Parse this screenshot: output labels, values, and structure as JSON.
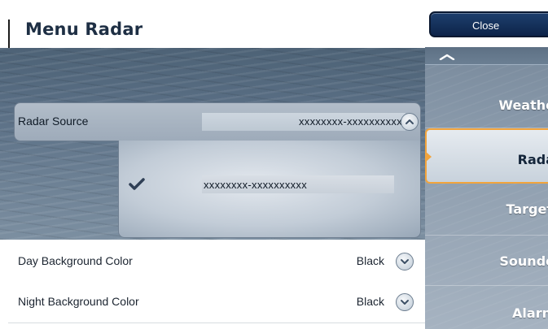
{
  "header": {
    "title": "Menu Radar"
  },
  "radar_source": {
    "label": "Radar Source",
    "value": "xxxxxxxx-xxxxxxxxxx",
    "expanded": true,
    "options": [
      {
        "value": "xxxxxxxx-xxxxxxxxxx",
        "selected": true
      }
    ]
  },
  "settings": [
    {
      "label": "Day Background Color",
      "value": "Black"
    },
    {
      "label": "Night Background Color",
      "value": "Black"
    }
  ],
  "sidebar": {
    "close_label": "Close",
    "items": [
      {
        "label": "Weathe",
        "selected": false
      },
      {
        "label": "Rada",
        "selected": true
      },
      {
        "label": "Target",
        "selected": false
      },
      {
        "label": "Sounde",
        "selected": false
      },
      {
        "label": "Alarn",
        "selected": false
      }
    ]
  },
  "colors": {
    "title_text": "#1e2f44",
    "close_button": "#0d2449",
    "selection_accent": "#f2a43c",
    "check_mark": "#2f3f55"
  },
  "icons": {
    "scroll_up": "chevron-up-icon",
    "collapse_source": "chevron-up-circle-icon",
    "selected_option": "checkmark-icon",
    "expand_setting": "chevron-down-circle-icon"
  }
}
